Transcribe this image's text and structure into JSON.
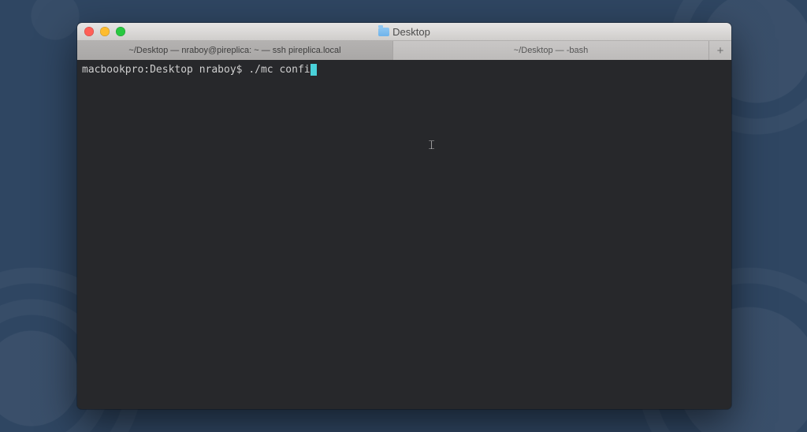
{
  "window": {
    "title": "Desktop"
  },
  "tabs": [
    {
      "label": "~/Desktop — nraboy@pireplica: ~ — ssh pireplica.local",
      "active": true
    },
    {
      "label": "~/Desktop — -bash",
      "active": false
    }
  ],
  "new_tab_glyph": "+",
  "terminal": {
    "prompt": "macbookpro:Desktop nraboy$ ",
    "command": "./mc confi"
  },
  "pointer_glyph": "𝙸",
  "colors": {
    "cursor": "#49d1d9",
    "terminal_bg": "#27282b",
    "desktop_bg": "#2f4662"
  }
}
